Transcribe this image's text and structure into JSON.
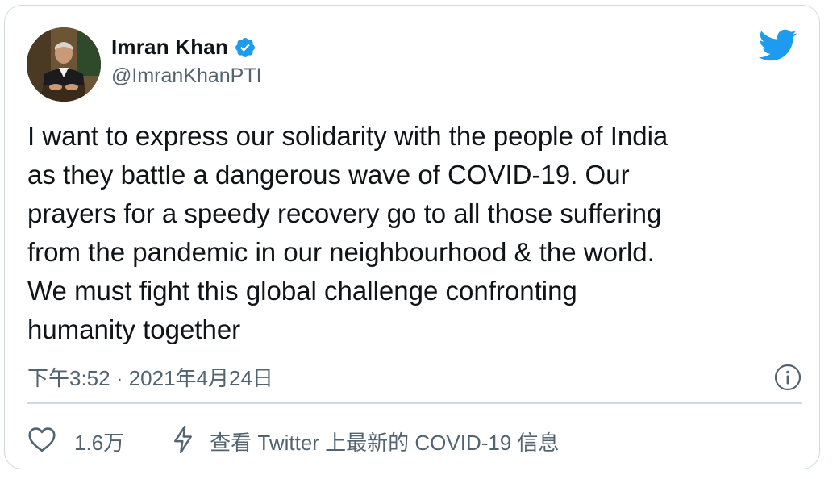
{
  "author": {
    "name": "Imran Khan",
    "handle": "@ImranKhanPTI",
    "verified": true,
    "avatar_icon": "profile-photo"
  },
  "brand": {
    "icon": "twitter-bird-icon",
    "color": "#1d9bf0"
  },
  "tweet": {
    "lines": [
      "I want to express our solidarity with the people of India",
      "as they battle a dangerous wave of COVID-19. Our",
      "prayers for a speedy recovery go to all those suffering",
      "from the pandemic in our neighbourhood & the world.",
      "We must fight this global challenge confronting",
      "humanity together"
    ]
  },
  "meta": {
    "timestamp": "下午3:52 · 2021年4月24日",
    "info_icon": "info-icon"
  },
  "actions": {
    "like_icon": "heart-icon",
    "like_count": "1.6万",
    "covid_icon": "lightning-icon",
    "covid_label": "查看 Twitter 上最新的 COVID-19 信息"
  },
  "colors": {
    "text": "#0f1419",
    "secondary": "#536471",
    "border": "#cfd9de",
    "accent": "#1d9bf0"
  }
}
